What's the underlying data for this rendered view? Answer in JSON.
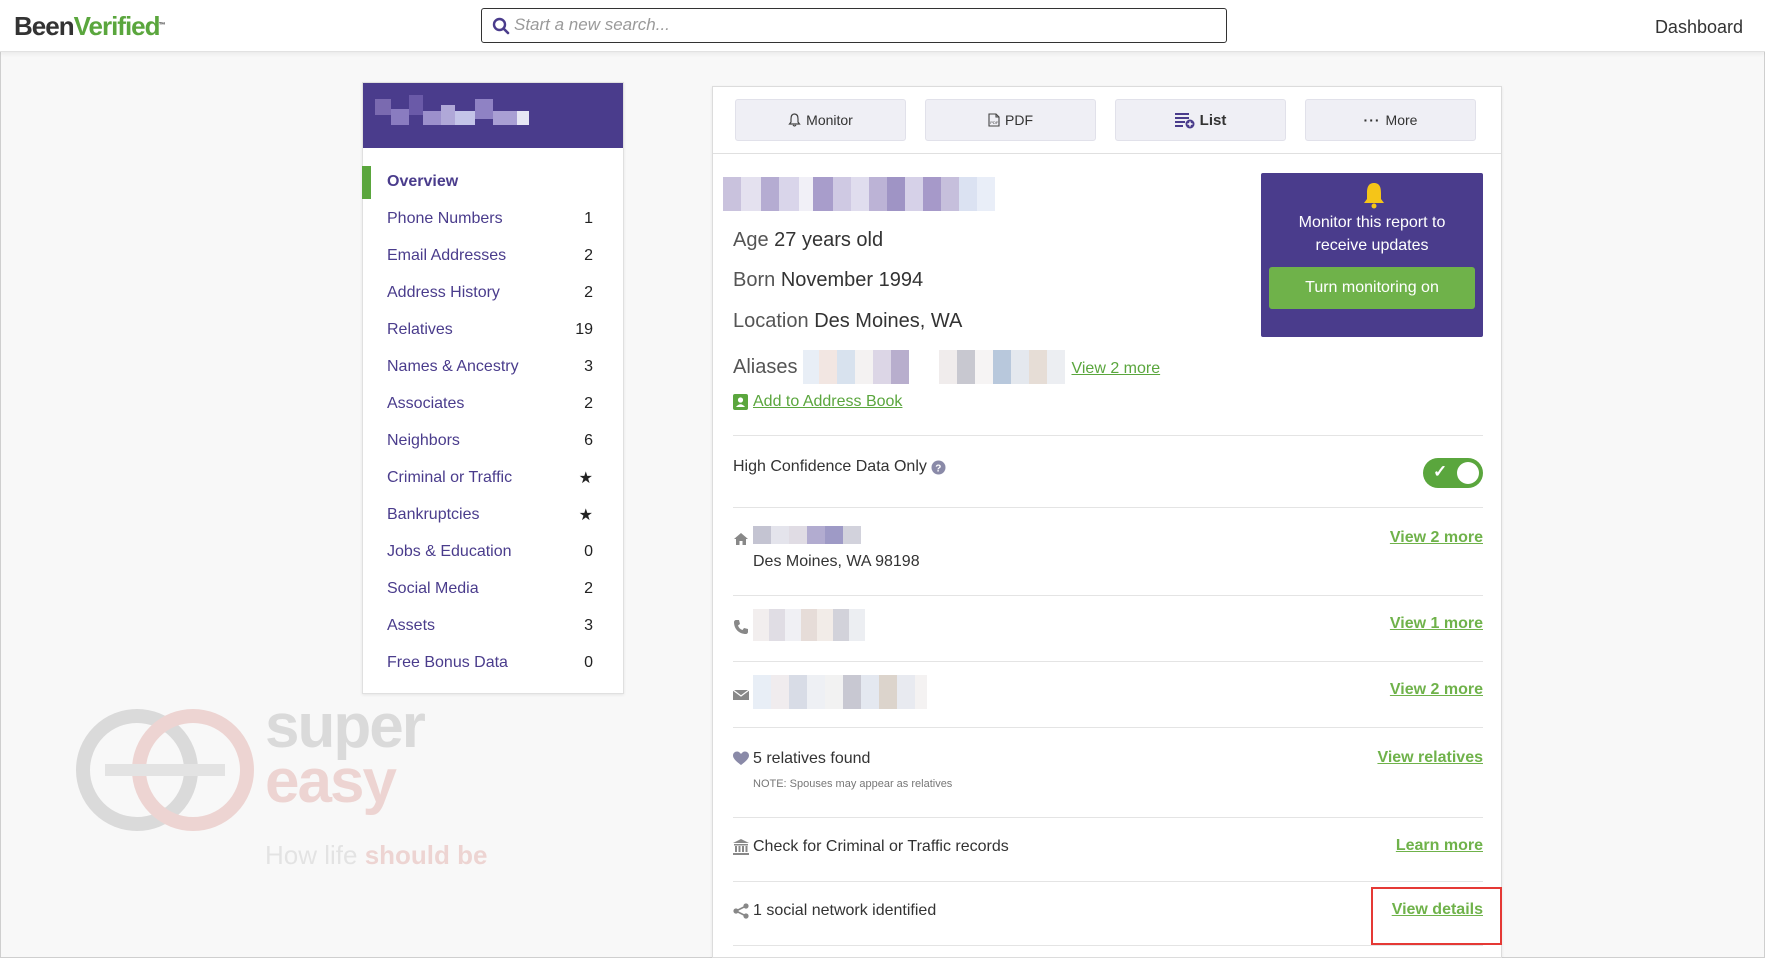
{
  "header": {
    "logo_part1": "Been",
    "logo_part2": "Verified",
    "logo_suffix": "™",
    "search_placeholder": "Start a new search...",
    "dashboard_label": "Dashboard"
  },
  "sidebar": {
    "items": [
      {
        "label": "Overview",
        "count": ""
      },
      {
        "label": "Phone Numbers",
        "count": "1"
      },
      {
        "label": "Email Addresses",
        "count": "2"
      },
      {
        "label": "Address History",
        "count": "2"
      },
      {
        "label": "Relatives",
        "count": "19"
      },
      {
        "label": "Names & Ancestry",
        "count": "3"
      },
      {
        "label": "Associates",
        "count": "2"
      },
      {
        "label": "Neighbors",
        "count": "6"
      },
      {
        "label": "Criminal or Traffic",
        "count": "★"
      },
      {
        "label": "Bankruptcies",
        "count": "★"
      },
      {
        "label": "Jobs & Education",
        "count": "0"
      },
      {
        "label": "Social Media",
        "count": "2"
      },
      {
        "label": "Assets",
        "count": "3"
      },
      {
        "label": "Free Bonus Data",
        "count": "0"
      }
    ]
  },
  "toolbar": {
    "monitor": "Monitor",
    "pdf": "PDF",
    "list": "List",
    "more": "More"
  },
  "profile": {
    "age_label": "Age",
    "age_value": "27 years old",
    "born_label": "Born",
    "born_value": "November 1994",
    "location_label": "Location",
    "location_value": "Des Moines, WA",
    "aliases_label": "Aliases",
    "aliases_link": "View 2 more",
    "add_address_book": "Add to Address Book"
  },
  "monitor_box": {
    "message": "Monitor this report to receive updates",
    "button": "Turn monitoring on"
  },
  "rows": {
    "high_confidence": "High Confidence Data Only",
    "address_city": "Des Moines, WA 98198",
    "address_link": "View 2 more",
    "phone_link": "View 1 more",
    "email_link": "View 2 more",
    "relatives_text": "5 relatives found",
    "relatives_note": "NOTE: Spouses may appear as relatives",
    "relatives_link": "View relatives",
    "criminal_text": "Check for Criminal or Traffic records",
    "criminal_link": "Learn more",
    "social_text": "1 social network identified",
    "social_link": "View details"
  },
  "watermark": {
    "line1": "super",
    "line2": "easy",
    "tag_a": "How life ",
    "tag_b": "should be"
  },
  "colors": {
    "brand_purple": "#4a3c8c",
    "brand_green": "#5aa63d",
    "highlight_red": "#e53935"
  }
}
